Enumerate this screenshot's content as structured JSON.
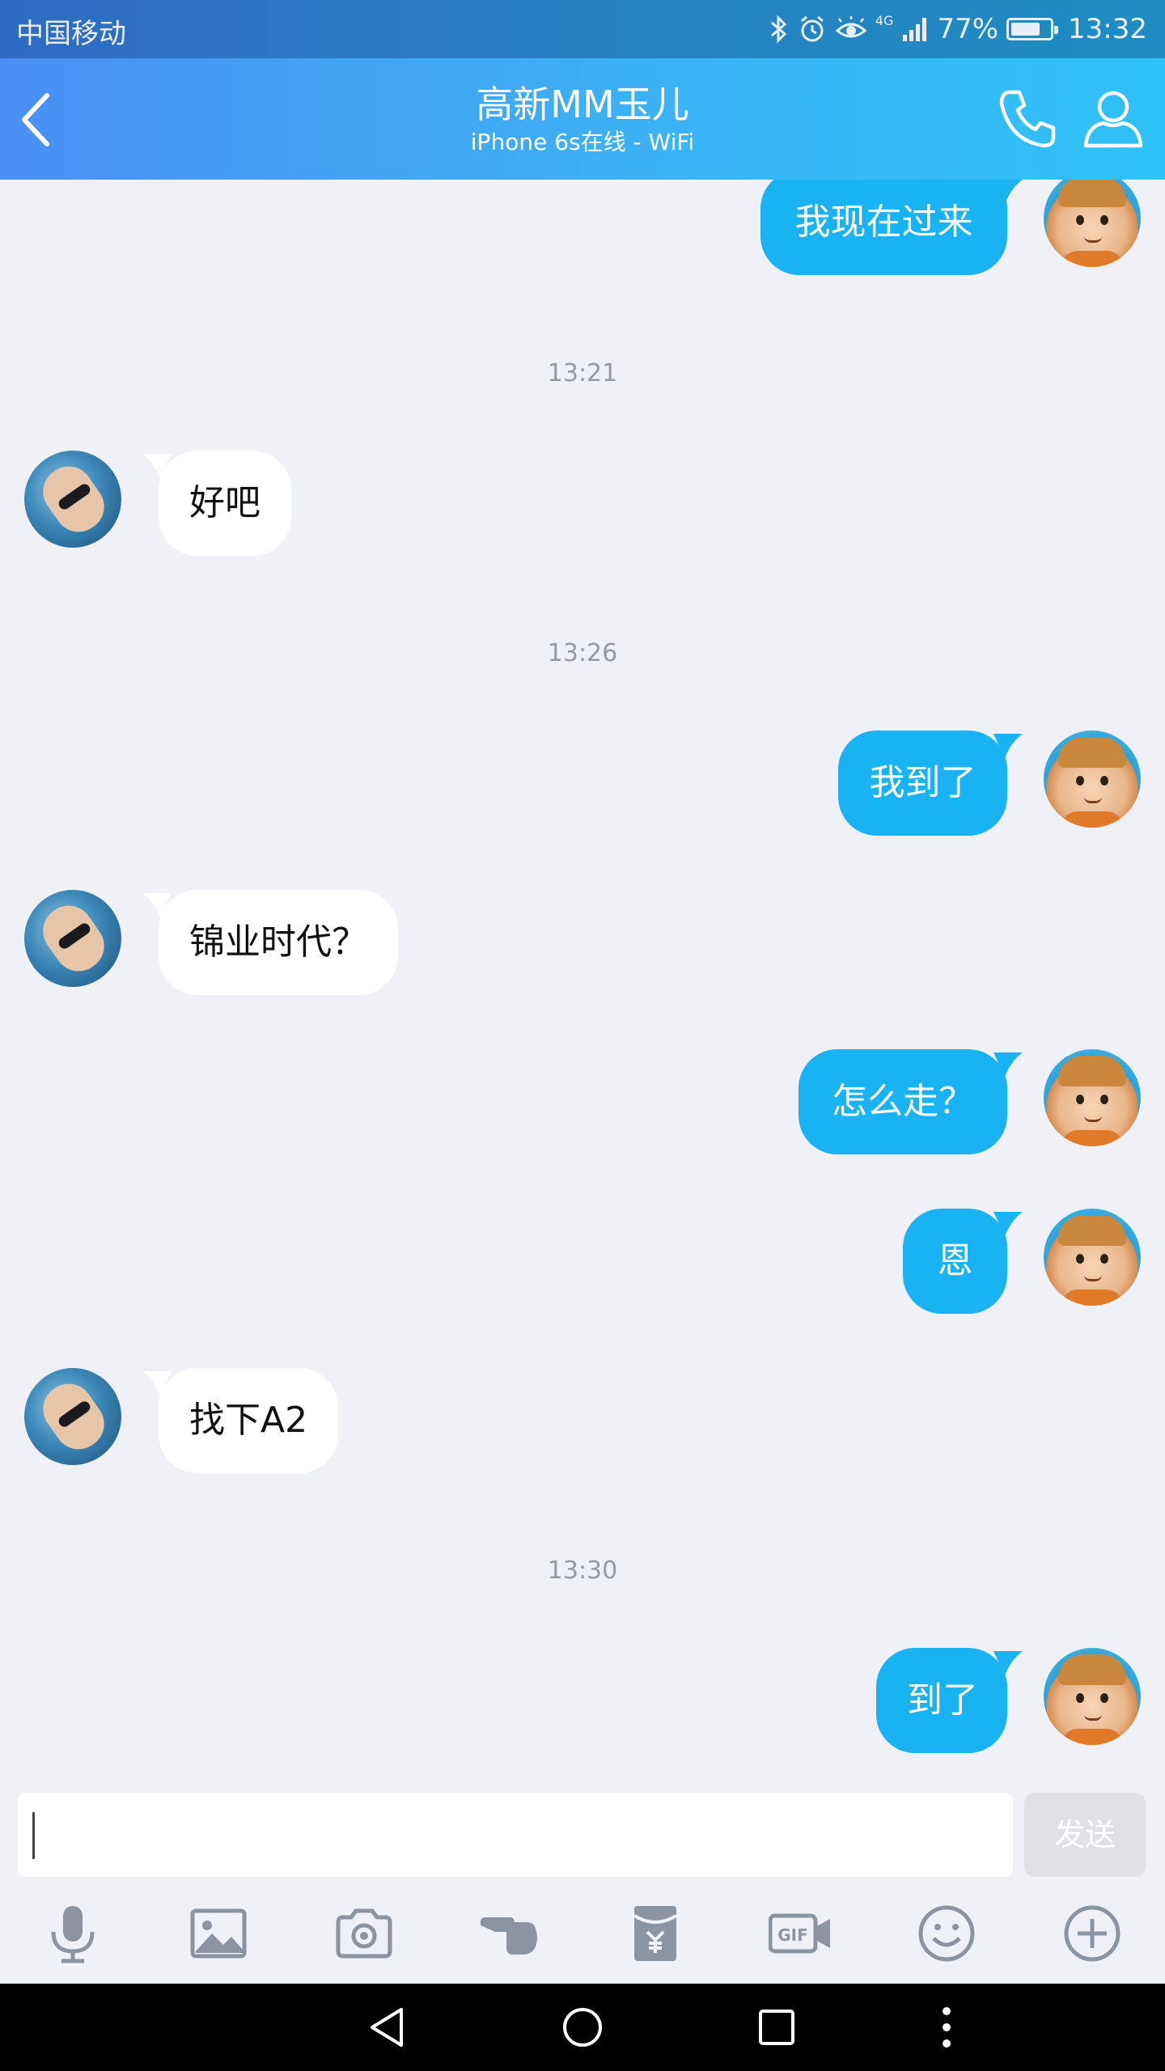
{
  "status_bar": {
    "carrier": "中国移动",
    "network": "4G",
    "battery_percent": "77%",
    "battery_level": 0.77,
    "time": "13:32"
  },
  "header": {
    "title": "高新MM玉儿",
    "subtitle": "iPhone 6s在线 - WiFi",
    "gradient_start": "#4a8ff5",
    "gradient_end": "#2ec2f6"
  },
  "messages": [
    {
      "sender": "me",
      "text": "我现在过来"
    },
    {
      "type": "timestamp",
      "text": "13:21"
    },
    {
      "sender": "her",
      "text": "好吧"
    },
    {
      "type": "timestamp",
      "text": "13:26"
    },
    {
      "sender": "me",
      "text": "我到了"
    },
    {
      "sender": "her",
      "text": "锦业时代？"
    },
    {
      "sender": "me",
      "text": "怎么走？"
    },
    {
      "sender": "me",
      "text": "恩"
    },
    {
      "sender": "her",
      "text": "找下A2"
    },
    {
      "type": "timestamp",
      "text": "13:30"
    },
    {
      "sender": "me",
      "text": "到了"
    }
  ],
  "input": {
    "value": "",
    "send_label": "发送"
  },
  "toolbar": {
    "icons": [
      "microphone-icon",
      "image-icon",
      "camera-icon",
      "poke-hand-icon",
      "red-packet-icon",
      "gif-icon",
      "emoji-icon",
      "plus-icon"
    ]
  },
  "nav": {
    "icons": [
      "back-triangle-icon",
      "home-circle-icon",
      "recents-square-icon",
      "more-dots-icon"
    ]
  },
  "colors": {
    "my_bubble": "#19b2f2",
    "her_bubble": "#ffffff",
    "background": "#f0f1f6",
    "timestamp": "#9599a2",
    "icon": "#8c93a1"
  }
}
